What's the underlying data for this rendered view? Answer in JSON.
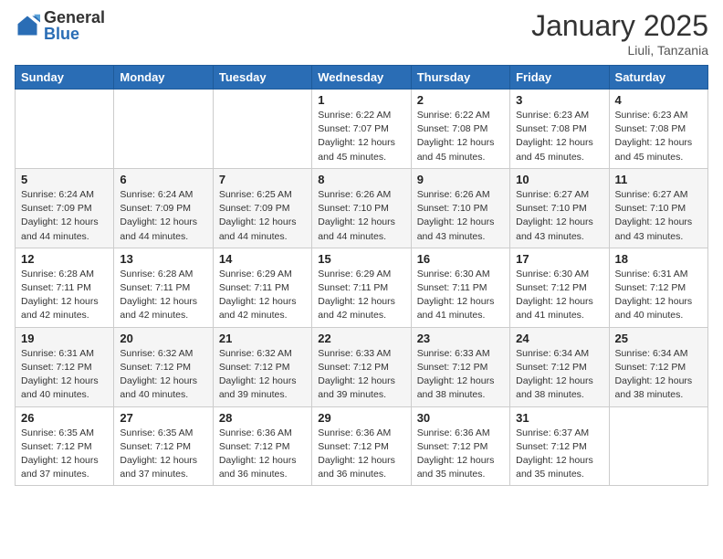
{
  "header": {
    "logo_general": "General",
    "logo_blue": "Blue",
    "month_title": "January 2025",
    "location": "Liuli, Tanzania"
  },
  "days_of_week": [
    "Sunday",
    "Monday",
    "Tuesday",
    "Wednesday",
    "Thursday",
    "Friday",
    "Saturday"
  ],
  "weeks": [
    [
      {
        "day": "",
        "info": ""
      },
      {
        "day": "",
        "info": ""
      },
      {
        "day": "",
        "info": ""
      },
      {
        "day": "1",
        "info": "Sunrise: 6:22 AM\nSunset: 7:07 PM\nDaylight: 12 hours and 45 minutes."
      },
      {
        "day": "2",
        "info": "Sunrise: 6:22 AM\nSunset: 7:08 PM\nDaylight: 12 hours and 45 minutes."
      },
      {
        "day": "3",
        "info": "Sunrise: 6:23 AM\nSunset: 7:08 PM\nDaylight: 12 hours and 45 minutes."
      },
      {
        "day": "4",
        "info": "Sunrise: 6:23 AM\nSunset: 7:08 PM\nDaylight: 12 hours and 45 minutes."
      }
    ],
    [
      {
        "day": "5",
        "info": "Sunrise: 6:24 AM\nSunset: 7:09 PM\nDaylight: 12 hours and 44 minutes."
      },
      {
        "day": "6",
        "info": "Sunrise: 6:24 AM\nSunset: 7:09 PM\nDaylight: 12 hours and 44 minutes."
      },
      {
        "day": "7",
        "info": "Sunrise: 6:25 AM\nSunset: 7:09 PM\nDaylight: 12 hours and 44 minutes."
      },
      {
        "day": "8",
        "info": "Sunrise: 6:26 AM\nSunset: 7:10 PM\nDaylight: 12 hours and 44 minutes."
      },
      {
        "day": "9",
        "info": "Sunrise: 6:26 AM\nSunset: 7:10 PM\nDaylight: 12 hours and 43 minutes."
      },
      {
        "day": "10",
        "info": "Sunrise: 6:27 AM\nSunset: 7:10 PM\nDaylight: 12 hours and 43 minutes."
      },
      {
        "day": "11",
        "info": "Sunrise: 6:27 AM\nSunset: 7:10 PM\nDaylight: 12 hours and 43 minutes."
      }
    ],
    [
      {
        "day": "12",
        "info": "Sunrise: 6:28 AM\nSunset: 7:11 PM\nDaylight: 12 hours and 42 minutes."
      },
      {
        "day": "13",
        "info": "Sunrise: 6:28 AM\nSunset: 7:11 PM\nDaylight: 12 hours and 42 minutes."
      },
      {
        "day": "14",
        "info": "Sunrise: 6:29 AM\nSunset: 7:11 PM\nDaylight: 12 hours and 42 minutes."
      },
      {
        "day": "15",
        "info": "Sunrise: 6:29 AM\nSunset: 7:11 PM\nDaylight: 12 hours and 42 minutes."
      },
      {
        "day": "16",
        "info": "Sunrise: 6:30 AM\nSunset: 7:11 PM\nDaylight: 12 hours and 41 minutes."
      },
      {
        "day": "17",
        "info": "Sunrise: 6:30 AM\nSunset: 7:12 PM\nDaylight: 12 hours and 41 minutes."
      },
      {
        "day": "18",
        "info": "Sunrise: 6:31 AM\nSunset: 7:12 PM\nDaylight: 12 hours and 40 minutes."
      }
    ],
    [
      {
        "day": "19",
        "info": "Sunrise: 6:31 AM\nSunset: 7:12 PM\nDaylight: 12 hours and 40 minutes."
      },
      {
        "day": "20",
        "info": "Sunrise: 6:32 AM\nSunset: 7:12 PM\nDaylight: 12 hours and 40 minutes."
      },
      {
        "day": "21",
        "info": "Sunrise: 6:32 AM\nSunset: 7:12 PM\nDaylight: 12 hours and 39 minutes."
      },
      {
        "day": "22",
        "info": "Sunrise: 6:33 AM\nSunset: 7:12 PM\nDaylight: 12 hours and 39 minutes."
      },
      {
        "day": "23",
        "info": "Sunrise: 6:33 AM\nSunset: 7:12 PM\nDaylight: 12 hours and 38 minutes."
      },
      {
        "day": "24",
        "info": "Sunrise: 6:34 AM\nSunset: 7:12 PM\nDaylight: 12 hours and 38 minutes."
      },
      {
        "day": "25",
        "info": "Sunrise: 6:34 AM\nSunset: 7:12 PM\nDaylight: 12 hours and 38 minutes."
      }
    ],
    [
      {
        "day": "26",
        "info": "Sunrise: 6:35 AM\nSunset: 7:12 PM\nDaylight: 12 hours and 37 minutes."
      },
      {
        "day": "27",
        "info": "Sunrise: 6:35 AM\nSunset: 7:12 PM\nDaylight: 12 hours and 37 minutes."
      },
      {
        "day": "28",
        "info": "Sunrise: 6:36 AM\nSunset: 7:12 PM\nDaylight: 12 hours and 36 minutes."
      },
      {
        "day": "29",
        "info": "Sunrise: 6:36 AM\nSunset: 7:12 PM\nDaylight: 12 hours and 36 minutes."
      },
      {
        "day": "30",
        "info": "Sunrise: 6:36 AM\nSunset: 7:12 PM\nDaylight: 12 hours and 35 minutes."
      },
      {
        "day": "31",
        "info": "Sunrise: 6:37 AM\nSunset: 7:12 PM\nDaylight: 12 hours and 35 minutes."
      },
      {
        "day": "",
        "info": ""
      }
    ]
  ]
}
